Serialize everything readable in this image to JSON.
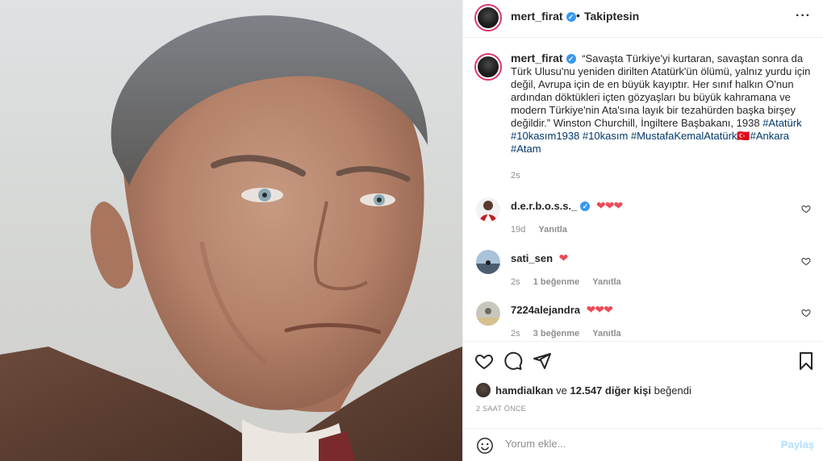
{
  "photo": {
    "alt": "Portre fotoğrafı"
  },
  "header": {
    "username": "mert_firat",
    "verified_icon": "verified-badge-icon",
    "separator": "•",
    "follow_label": "Takiptesin",
    "more_label": "···"
  },
  "caption": {
    "username": "mert_firat",
    "text": "“Savaşta Türkiye'yi kurtaran, savaştan sonra da Türk Ulusu'nu yeniden dirilten Atatürk'ün ölümü, yalnız yurdu için değil, Avrupa için de en büyük kayıptır. Her sınıf halkın O'nun ardından döktükleri içten gözyaşları bu büyük kahramana ve modern Türkiye'nin Ata'sına layık bir tezahürden başka birşey değildir.” Winston Churchill, İngiltere Başbakanı, 1938",
    "hashtags": [
      "#Atatürk",
      "#10kasım1938",
      "#10kasım",
      "#MustafaKemalAtatürk",
      "🇹🇷",
      "#Ankara",
      "#Atam"
    ],
    "time": "2s"
  },
  "comments": [
    {
      "username": "d.e.r.b.o.s.s._",
      "verified": true,
      "text": "❤❤❤",
      "time": "19d",
      "likes": "",
      "reply": "Yanıtla"
    },
    {
      "username": "sati_sen",
      "verified": false,
      "text": "❤",
      "time": "2s",
      "likes": "1 beğenme",
      "reply": "Yanıtla"
    },
    {
      "username": "7224alejandra",
      "verified": false,
      "text": "❤❤❤",
      "time": "2s",
      "likes": "3 beğenme",
      "reply": "Yanıtla"
    }
  ],
  "likes": {
    "user": "hamdialkan",
    "connector": "ve",
    "count": "12.547 diğer kişi",
    "suffix": "beğendi"
  },
  "post_time": "2 SAAT ÖNCE",
  "add_comment": {
    "placeholder": "Yorum ekle...",
    "share_label": "Paylaş"
  },
  "colors": {
    "link": "#00376b",
    "heart": "#ed4956",
    "muted": "#8e8e8e",
    "share_disabled": "#b2dffc",
    "verified": "#3897f0"
  }
}
